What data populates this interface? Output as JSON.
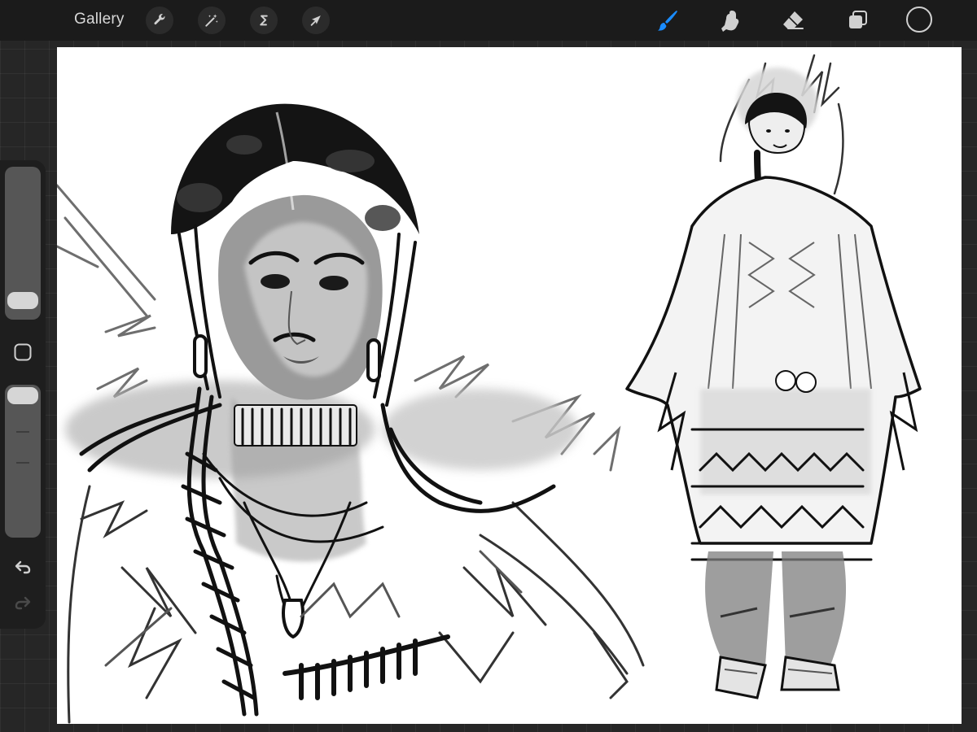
{
  "toolbar": {
    "gallery_label": "Gallery",
    "actions_icon": "wrench-icon",
    "adjustments_icon": "magic-wand-icon",
    "selection_icon": "selection-s-icon",
    "transform_icon": "arrow-cursor-icon",
    "brush_icon": "paintbrush-icon",
    "smudge_icon": "smudge-finger-icon",
    "eraser_icon": "eraser-icon",
    "layers_icon": "layers-icon",
    "active_tool": "brush",
    "accent_color": "#1a8cff",
    "current_color": "#1b1b1b"
  },
  "sidebar": {
    "brush_size_level": 0.06,
    "opacity_level": 1.0,
    "modify_icon": "square-modify-icon",
    "undo_icon": "undo-icon",
    "redo_icon": "redo-icon"
  },
  "canvas": {
    "background": "#ffffff"
  }
}
